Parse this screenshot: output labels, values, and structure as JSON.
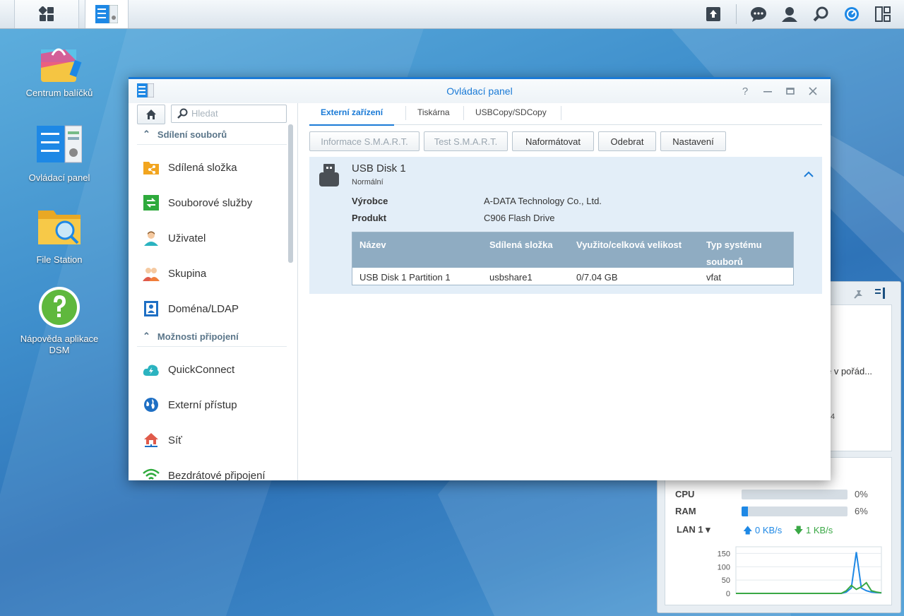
{
  "colors": {
    "accent": "#1a7ad6",
    "table_header": "#8facc2",
    "device_bg": "#e3eef8",
    "bar_fill": "#1e88e5"
  },
  "taskbar": {
    "icons": [
      "apps-grid-icon",
      "control-panel-icon",
      "upload-icon",
      "chat-icon",
      "user-icon",
      "search-icon",
      "dashboard-icon",
      "widgets-icon"
    ]
  },
  "desktop": {
    "icons": [
      {
        "label": "Centrum balíčků",
        "icon": "package-center-icon"
      },
      {
        "label": "Ovládací panel",
        "icon": "control-panel-icon"
      },
      {
        "label": "File Station",
        "icon": "file-station-icon"
      },
      {
        "label": "Nápověda aplikace DSM",
        "icon": "help-icon"
      }
    ]
  },
  "widget": {
    "partial_text_1": "e v pořád...",
    "partial_text_2": "4",
    "cpu_label": "CPU",
    "cpu_pct": "0%",
    "cpu_value": 0,
    "ram_label": "RAM",
    "ram_pct": "6%",
    "ram_value": 6,
    "lan_label": "LAN 1 ▾",
    "upload": "0 KB/s",
    "download": "1 KB/s",
    "chart_data": {
      "type": "line",
      "yticks": [
        "150",
        "100",
        "50",
        "0"
      ],
      "ylim": [
        0,
        175
      ],
      "series": [
        {
          "color": "#1e88e5",
          "values": [
            0,
            0,
            0,
            0,
            0,
            0,
            0,
            0,
            0,
            0,
            0,
            0,
            0,
            0,
            0,
            0,
            0,
            0,
            0,
            0,
            0,
            0,
            5,
            20,
            155,
            20,
            10,
            5,
            3,
            2
          ]
        },
        {
          "color": "#3aa845",
          "values": [
            0,
            0,
            0,
            0,
            0,
            0,
            0,
            0,
            0,
            0,
            0,
            0,
            0,
            0,
            0,
            0,
            0,
            0,
            0,
            0,
            0,
            0,
            10,
            30,
            15,
            25,
            40,
            10,
            5,
            2
          ]
        }
      ]
    }
  },
  "window": {
    "title": "Ovládací panel",
    "controls": [
      "help-icon",
      "minimize-icon",
      "maximize-icon",
      "close-icon"
    ],
    "search_placeholder": "Hledat",
    "sections": [
      {
        "title": "Sdílení souborů",
        "items": [
          {
            "label": "Sdílená složka",
            "icon": "shared-folder-icon"
          },
          {
            "label": "Souborové služby",
            "icon": "file-services-icon"
          },
          {
            "label": "Uživatel",
            "icon": "user-icon"
          },
          {
            "label": "Skupina",
            "icon": "group-icon"
          },
          {
            "label": "Doména/LDAP",
            "icon": "domain-ldap-icon"
          }
        ]
      },
      {
        "title": "Možnosti připojení",
        "items": [
          {
            "label": "QuickConnect",
            "icon": "quickconnect-icon"
          },
          {
            "label": "Externí přístup",
            "icon": "external-access-icon"
          },
          {
            "label": "Síť",
            "icon": "network-icon"
          },
          {
            "label": "Bezdrátové připojení",
            "icon": "wireless-icon"
          }
        ]
      }
    ],
    "tabs": [
      "Externí zařízení",
      "Tiskárna",
      "USBCopy/SDCopy"
    ],
    "buttons": {
      "smart_info": "Informace S.M.A.R.T.",
      "smart_test": "Test S.M.A.R.T.",
      "format": "Naformátovat",
      "remove": "Odebrat",
      "settings": "Nastavení"
    },
    "device": {
      "name": "USB Disk 1",
      "status": "Normální",
      "vendor_label": "Výrobce",
      "vendor": "A-DATA Technology Co., Ltd.",
      "product_label": "Produkt",
      "product": "C906 Flash Drive",
      "table": {
        "headers": [
          "Název",
          "Sdílená složka",
          "Využito/celková velikost",
          "Typ systému souborů"
        ],
        "rows": [
          [
            "USB Disk 1 Partition 1",
            "usbshare1",
            "0/7.04 GB",
            "vfat"
          ]
        ]
      }
    }
  }
}
